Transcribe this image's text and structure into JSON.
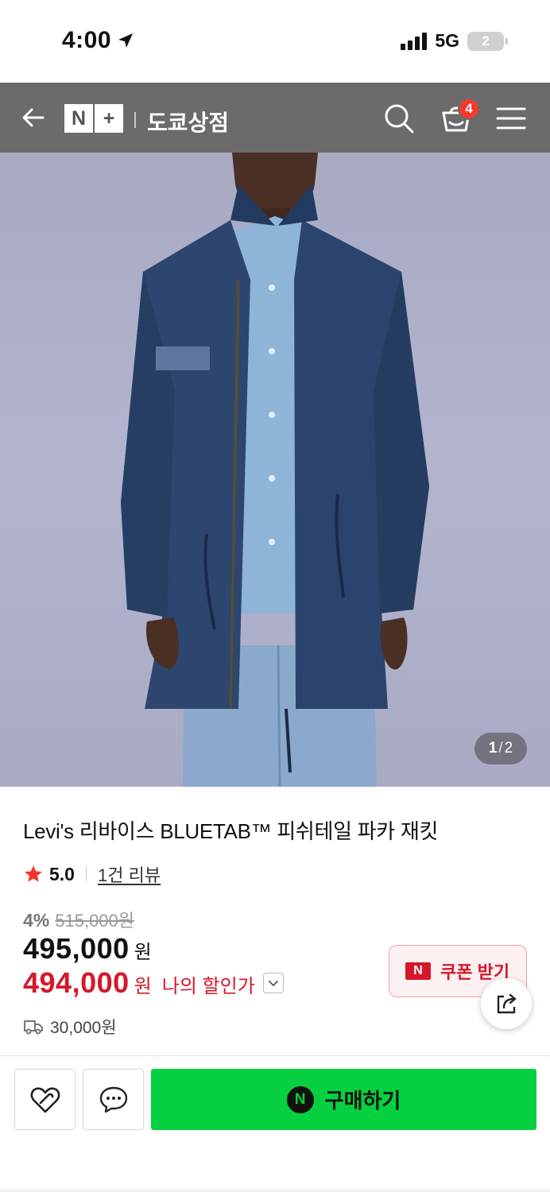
{
  "status_bar": {
    "time": "4:00",
    "network": "5G",
    "battery": "2"
  },
  "header": {
    "logo_left": "N",
    "logo_right": "+",
    "store_name": "도쿄상점",
    "cart_count": "4"
  },
  "gallery": {
    "current": "1",
    "separator": "/",
    "total": "2"
  },
  "product": {
    "title": "Levi's 리바이스 BLUETAB™ 피쉬테일 파카 재킷",
    "rating": "5.0",
    "review_link": "1건 리뷰",
    "discount_rate": "4%",
    "original_price": "515,000원",
    "price": "495,000",
    "price_unit": "원",
    "my_price": "494,000",
    "my_price_unit": "원",
    "my_price_label": "나의 할인가",
    "shipping_fee": "30,000원"
  },
  "coupon": {
    "badge": "N",
    "label": "쿠폰 받기"
  },
  "bottom_bar": {
    "buy_badge": "N",
    "buy_label": "구매하기"
  },
  "colors": {
    "header_bg": "#6b6b6b",
    "cart_badge": "#f23b2c",
    "sale_red": "#d6172b",
    "buy_green": "#06d03f"
  },
  "icons": [
    "location-arrow-icon",
    "signal-icon",
    "back-arrow-icon",
    "search-icon",
    "cart-icon",
    "menu-icon",
    "star-icon",
    "chevron-down-icon",
    "share-icon",
    "truck-icon",
    "wishlist-heart-icon",
    "talk-chat-icon"
  ]
}
